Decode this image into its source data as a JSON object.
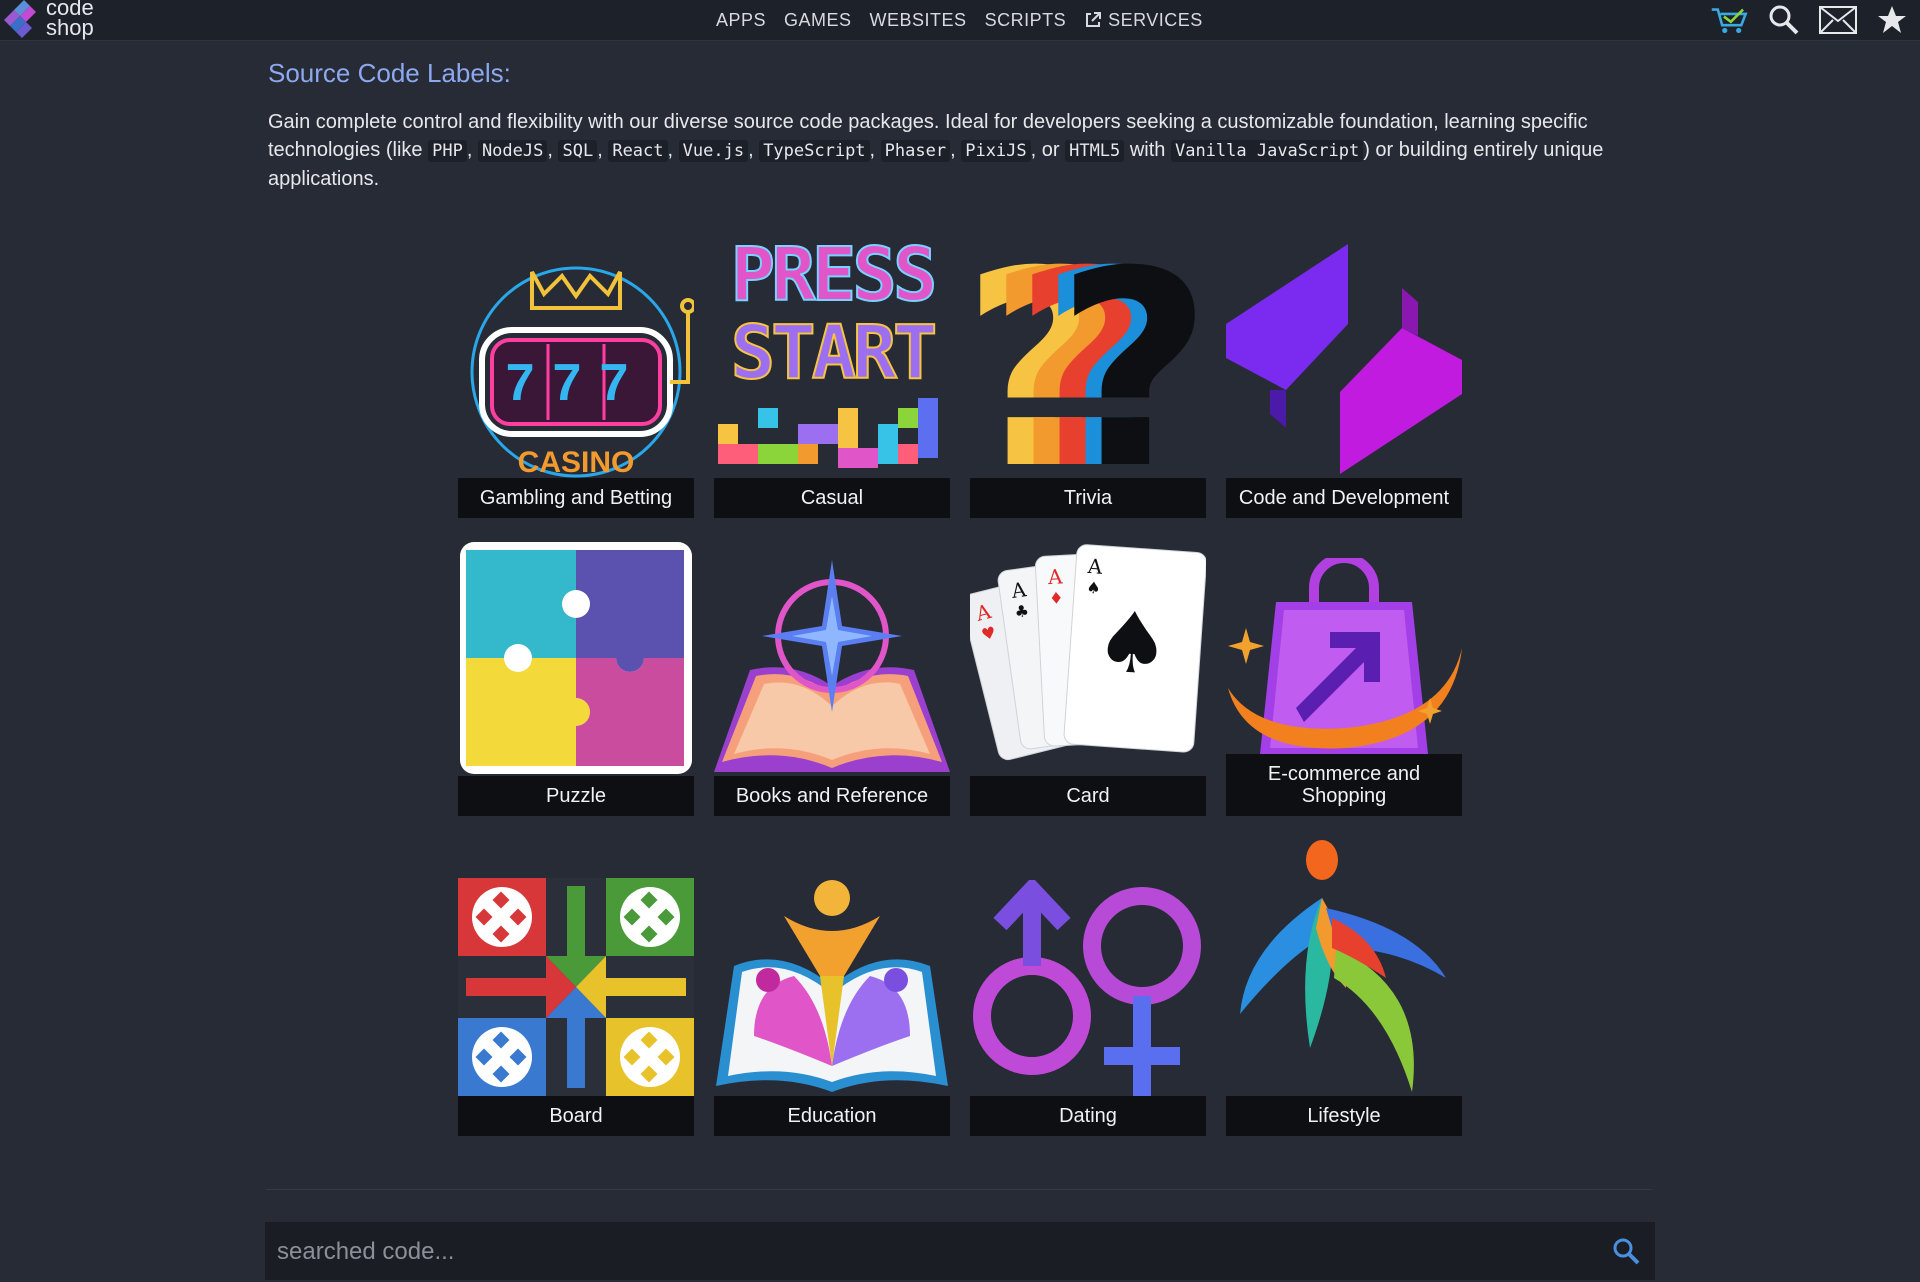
{
  "brand": {
    "line1": "code",
    "line2": "shop"
  },
  "nav": {
    "items": [
      {
        "label": "APPS"
      },
      {
        "label": "GAMES"
      },
      {
        "label": "WEBSITES"
      },
      {
        "label": "SCRIPTS"
      },
      {
        "label": "SERVICES",
        "icon": "external-link-icon"
      }
    ]
  },
  "tools": [
    "cart-icon",
    "search-icon",
    "mail-icon",
    "star-icon"
  ],
  "section": {
    "title": "Source Code Labels:",
    "intro": {
      "t1": "Gain complete control and flexibility with our diverse source code packages. Ideal for developers seeking a customizable foundation, learning specific technologies (like ",
      "c1": "PHP",
      "s1": ", ",
      "c2": "NodeJS",
      "s2": ", ",
      "c3": "SQL",
      "s3": ", ",
      "c4": "React",
      "s4": ", ",
      "c5": "Vue.js",
      "s5": ", ",
      "c6": "TypeScript",
      "s6": ", ",
      "c7": "Phaser",
      "s7": ", ",
      "c8": "PixiJS",
      "s8": ", or ",
      "c9": "HTML5",
      "s9": " with ",
      "c10": "Vanilla JavaScript",
      "t2": ") or building entirely unique applications."
    }
  },
  "categories": [
    {
      "label": "Gambling and Betting",
      "art": {
        "text": "CASINO",
        "reels": "777"
      }
    },
    {
      "label": "Casual",
      "art": {
        "line1": "PRESS",
        "line2": "START"
      }
    },
    {
      "label": "Trivia",
      "art": {
        "glyph": "?"
      }
    },
    {
      "label": "Code and Development"
    },
    {
      "label": "Puzzle"
    },
    {
      "label": "Books and Reference"
    },
    {
      "label": "Card",
      "art": {
        "rank": "A"
      }
    },
    {
      "label": "E-commerce and Shopping"
    },
    {
      "label": "Board"
    },
    {
      "label": "Education"
    },
    {
      "label": "Dating"
    },
    {
      "label": "Lifestyle"
    }
  ],
  "search": {
    "placeholder": "searched code..."
  },
  "colors": {
    "background": "#262b36",
    "topbar": "#1d212a",
    "heading": "#8ea8ef",
    "label_bg": "#0d0f13"
  }
}
